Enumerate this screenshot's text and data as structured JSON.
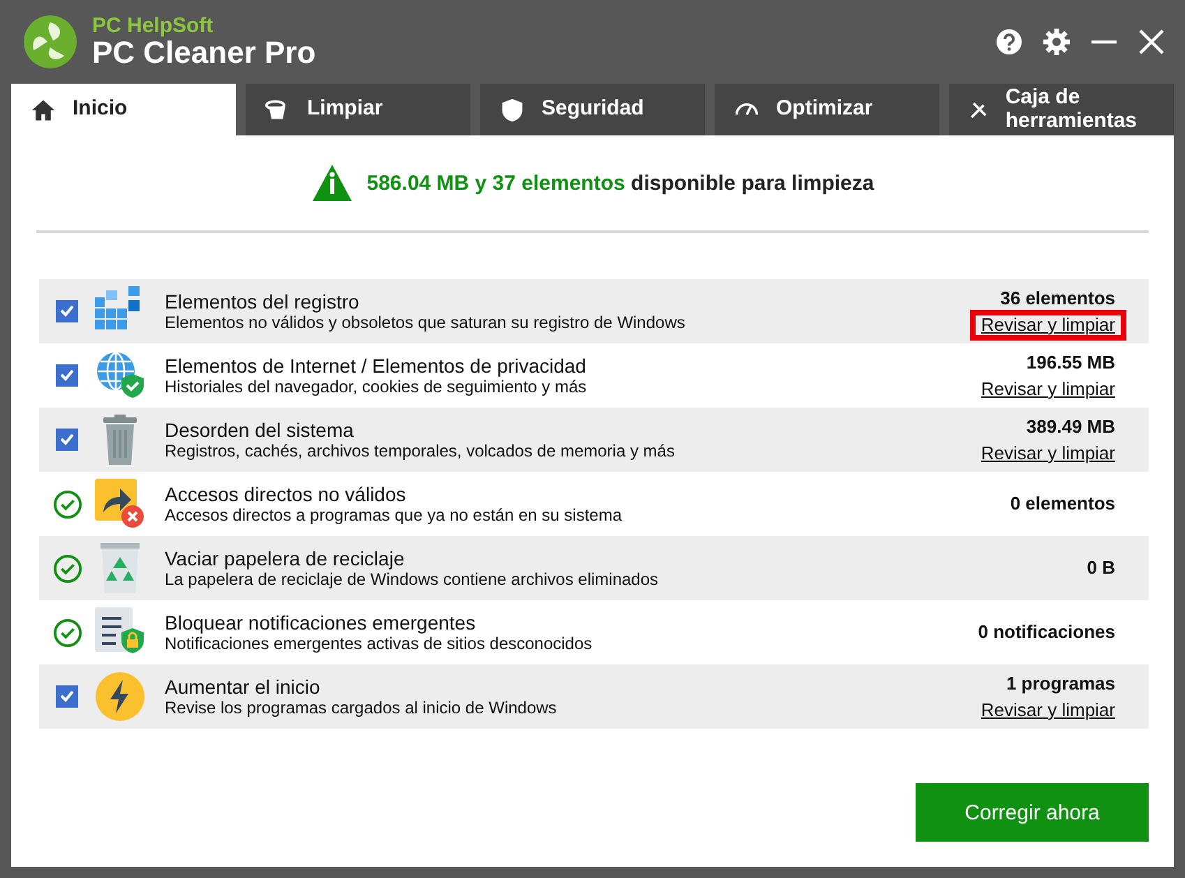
{
  "app": {
    "vendor": "PC HelpSoft",
    "title": "PC Cleaner Pro"
  },
  "tabs": [
    {
      "label": "Inicio",
      "selected": true
    },
    {
      "label": "Limpiar",
      "selected": false
    },
    {
      "label": "Seguridad",
      "selected": false
    },
    {
      "label": "Optimizar",
      "selected": false
    },
    {
      "label": "Caja de herramientas",
      "selected": false
    }
  ],
  "summary": {
    "amount": "586.04 MB y 37 elementos",
    "text": "disponible para limpieza"
  },
  "items": [
    {
      "kind": "checkbox",
      "checked": true,
      "title": "Elementos del registro",
      "description": "Elementos no válidos y obsoletos que saturan su registro de Windows",
      "value": "36 elementos",
      "link": "Revisar y limpiar",
      "highlighted": true
    },
    {
      "kind": "checkbox",
      "checked": true,
      "title": "Elementos de Internet / Elementos de privacidad",
      "description": "Historiales del navegador, cookies de seguimiento y más",
      "value": "196.55 MB",
      "link": "Revisar y limpiar",
      "highlighted": false
    },
    {
      "kind": "checkbox",
      "checked": true,
      "title": "Desorden del sistema",
      "description": "Registros, cachés, archivos temporales, volcados de memoria y más",
      "value": "389.49 MB",
      "link": "Revisar y limpiar",
      "highlighted": false
    },
    {
      "kind": "ok",
      "title": "Accesos directos no válidos",
      "description": "Accesos directos a programas que ya no están en su sistema",
      "value": "0 elementos"
    },
    {
      "kind": "ok",
      "title": "Vaciar papelera de reciclaje",
      "description": "La papelera de reciclaje de Windows contiene archivos eliminados",
      "value": "0 B"
    },
    {
      "kind": "ok",
      "title": "Bloquear notificaciones emergentes",
      "description": "Notificaciones emergentes activas de sitios desconocidos",
      "value": "0 notificaciones"
    },
    {
      "kind": "checkbox",
      "checked": true,
      "title": "Aumentar el inicio",
      "description": "Revise los programas cargados al inicio de Windows",
      "value": "1 programas",
      "link": "Revisar y limpiar",
      "highlighted": false
    }
  ],
  "button": "Corregir ahora"
}
